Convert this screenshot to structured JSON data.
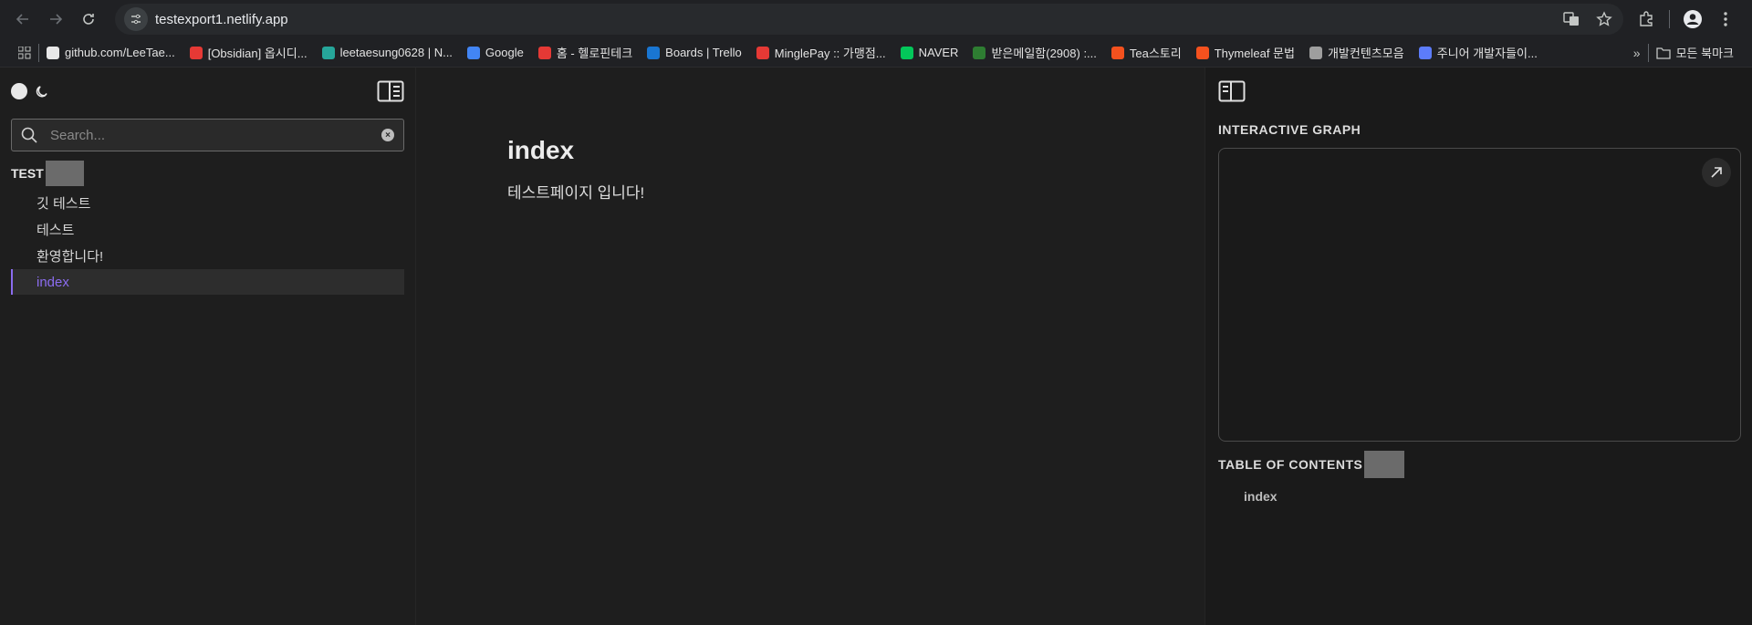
{
  "browser": {
    "url": "testexport1.netlify.app",
    "bookmarks": [
      {
        "label": "github.com/LeeTae...",
        "color": "#e8e8e8"
      },
      {
        "label": "[Obsidian] 옵시디...",
        "color": "#e53935"
      },
      {
        "label": "leetaesung0628 | N...",
        "color": "#26a69a"
      },
      {
        "label": "Google",
        "color": "#4285f4"
      },
      {
        "label": "홈 - 헬로핀테크",
        "color": "#e53935"
      },
      {
        "label": "Boards | Trello",
        "color": "#1976d2"
      },
      {
        "label": "MinglePay :: 가맹점...",
        "color": "#e53935"
      },
      {
        "label": "NAVER",
        "color": "#03c75a"
      },
      {
        "label": "받은메일함(2908) :...",
        "color": "#2e7d32"
      },
      {
        "label": "Tea스토리",
        "color": "#f4511e"
      },
      {
        "label": "Thymeleaf 문법",
        "color": "#f4511e"
      },
      {
        "label": "개발컨텐츠모음",
        "color": "#9e9e9e"
      },
      {
        "label": "주니어 개발자들이...",
        "color": "#5c7cfa"
      }
    ],
    "all_bookmarks": "모든 북마크"
  },
  "sidebar": {
    "search_placeholder": "Search...",
    "explorer_title": "TEST",
    "items": [
      {
        "label": "깃 테스트"
      },
      {
        "label": "테스트"
      },
      {
        "label": "환영합니다!"
      },
      {
        "label": "index"
      }
    ]
  },
  "document": {
    "title": "index",
    "body": "테스트페이지 입니다!"
  },
  "right_panel": {
    "graph_label": "INTERACTIVE GRAPH",
    "toc_label": "TABLE OF CONTENTS",
    "toc_items": [
      {
        "label": "index"
      }
    ]
  },
  "colors": {
    "accent": "#8b6cef"
  }
}
